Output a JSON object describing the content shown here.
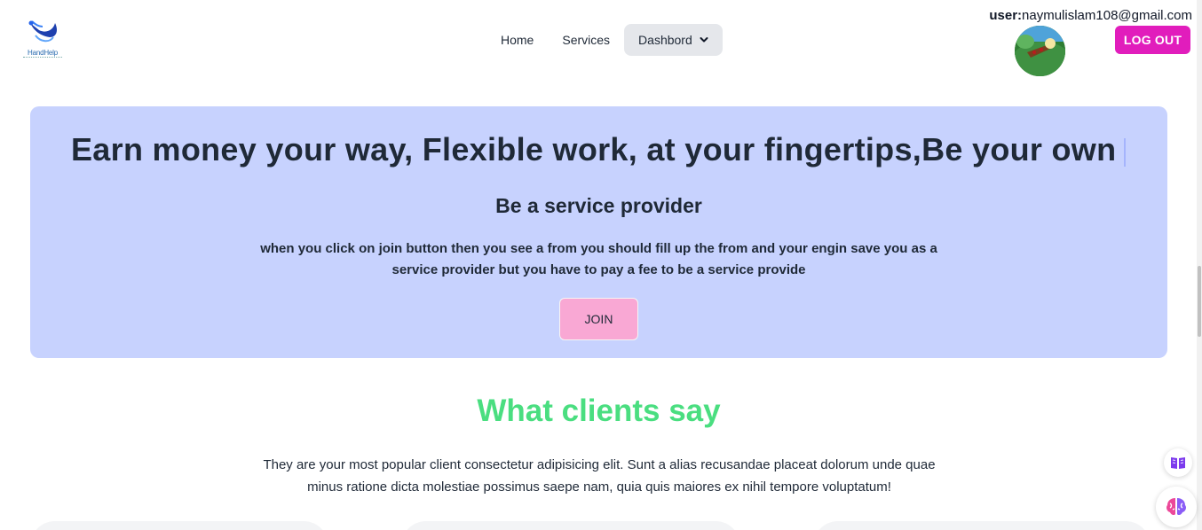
{
  "nav": {
    "logo_text": "HandHelp",
    "links": [
      "Home",
      "Services",
      "Dashbord"
    ],
    "user_label": "user:",
    "user_email": "naymulislam108@gmail.com",
    "logout": "LOG OUT"
  },
  "hero": {
    "marquee": "Earn money your way, Flexible work, at your fingertips,Be your own b",
    "subtitle": "Be a service provider",
    "description": "when you click on join button then you see a from you should fill up the from and your engin save you as a service provider but you have to pay a fee to be a service provide",
    "join": "JOIN"
  },
  "clients": {
    "title": "What clients say",
    "description": "They are your most popular client consectetur adipisicing elit. Sunt a alias recusandae placeat dolorum unde quae minus ratione dicta molestiae possimus saepe nam, quia quis maiores ex nihil tempore voluptatum!"
  },
  "colors": {
    "hero_bg": "#c7d2fe",
    "logout_bg": "#e11dbc",
    "join_bg": "#f9a8d4",
    "clients_title": "#4ade80"
  },
  "icons": {
    "dashboard_dropdown": "chevron-down-icon",
    "reader": "book-icon",
    "ai": "brain-icon"
  }
}
